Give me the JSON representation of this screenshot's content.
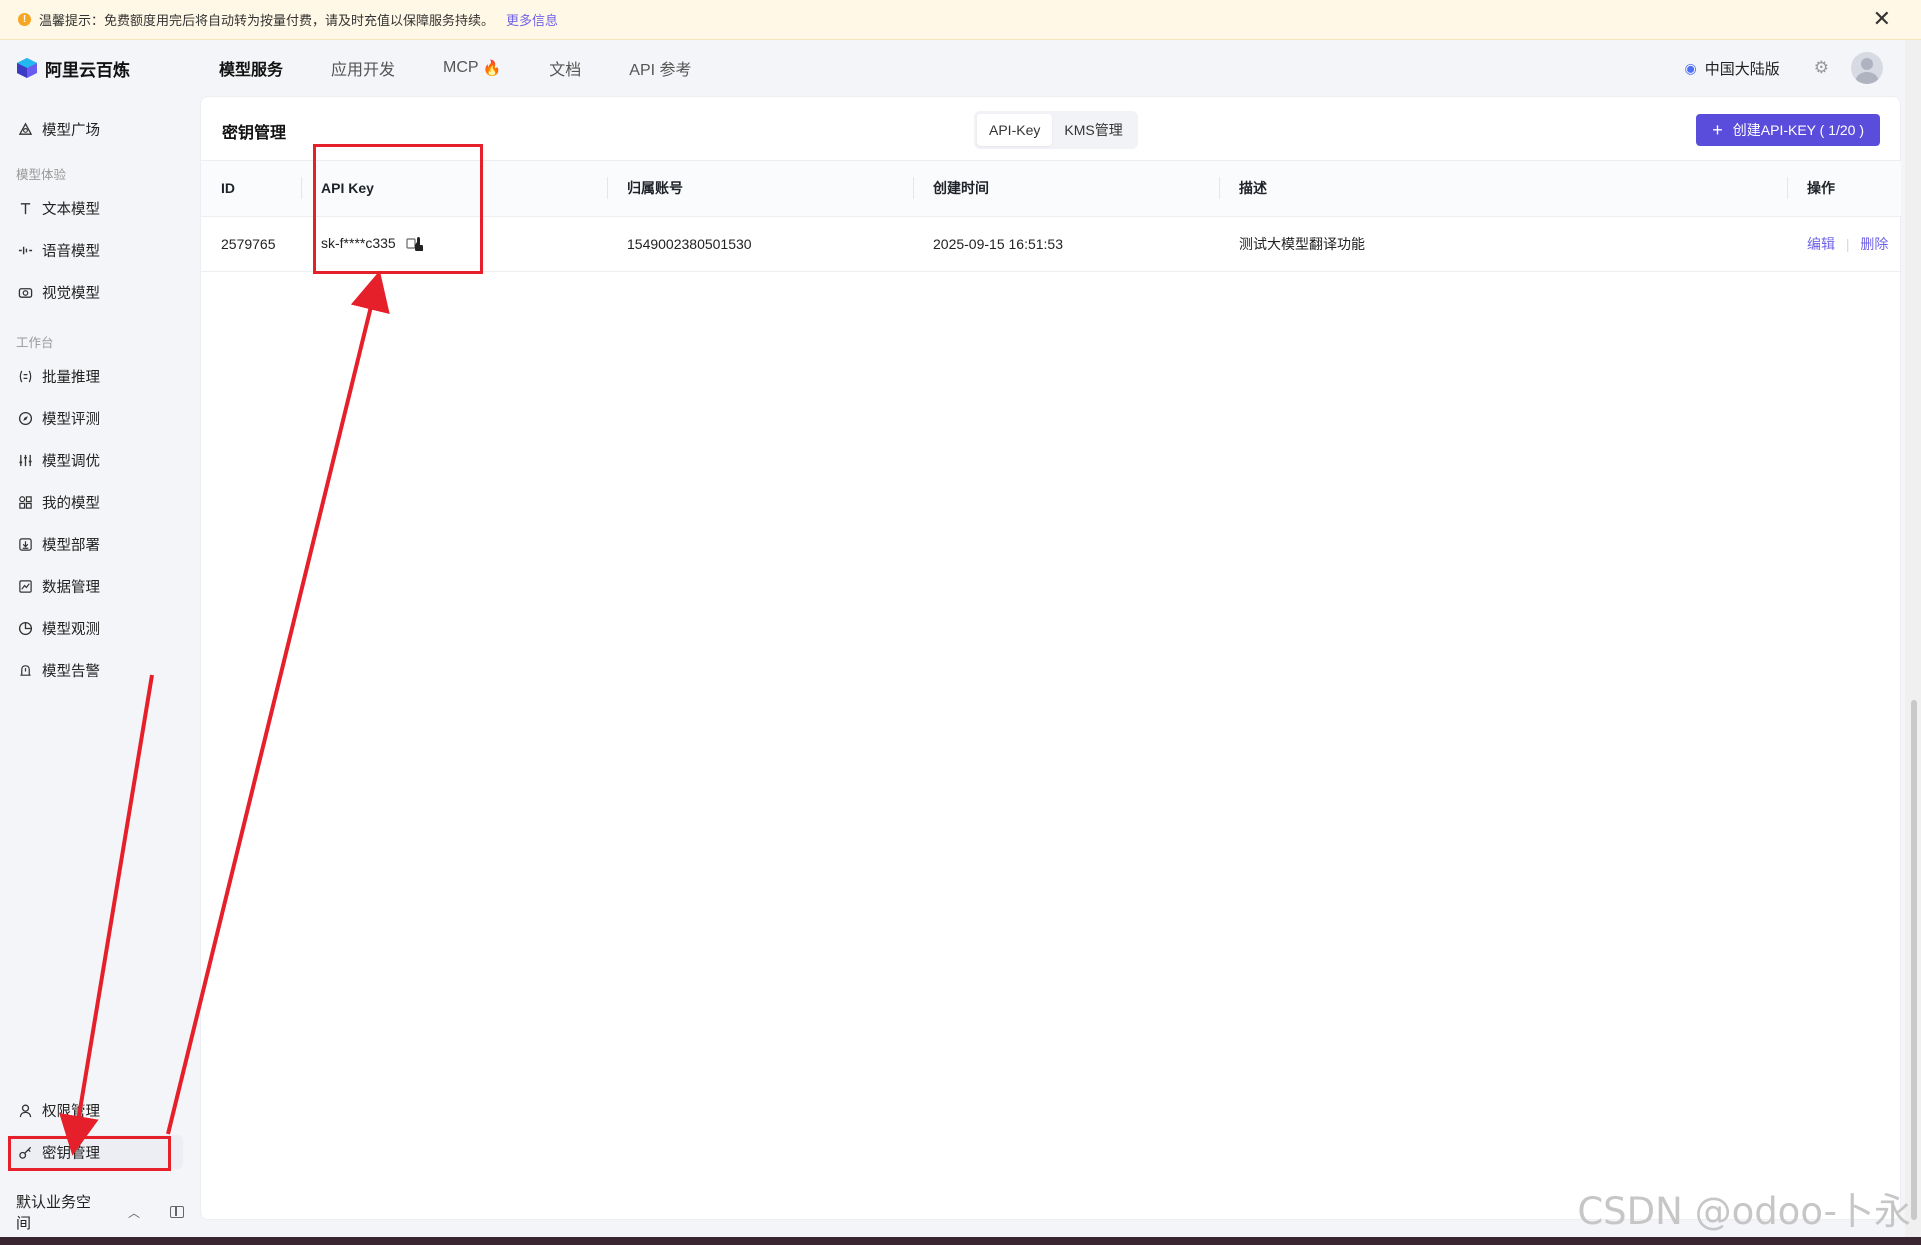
{
  "notice": {
    "text": "温馨提示：免费额度用完后将自动转为按量付费，请及时充值以保障服务持续。",
    "more_link": "更多信息"
  },
  "topnav": {
    "brand": "阿里云百炼",
    "items": [
      "模型服务",
      "应用开发",
      "MCP",
      "文档",
      "API 参考"
    ],
    "active": "模型服务",
    "region": "中国大陆版"
  },
  "sidebar": {
    "model_plaza": "模型广场",
    "group_experience": "模型体验",
    "experience_items": [
      "文本模型",
      "语音模型",
      "视觉模型"
    ],
    "group_workbench": "工作台",
    "workbench_items": [
      "批量推理",
      "模型评测",
      "模型调优",
      "我的模型",
      "模型部署",
      "数据管理",
      "模型观测",
      "模型告警"
    ],
    "bottom_items": [
      "权限管理",
      "密钥管理"
    ],
    "active": "密钥管理",
    "workspace": "默认业务空间"
  },
  "main": {
    "title": "密钥管理",
    "tabs": [
      "API-Key",
      "KMS管理"
    ],
    "active_tab": "API-Key",
    "create_button": "创建API-KEY ( 1/20 )",
    "table": {
      "columns": [
        "ID",
        "API Key",
        "归属账号",
        "创建时间",
        "描述",
        "操作"
      ],
      "rows": [
        {
          "id": "2579765",
          "api_key": "sk-f****c335",
          "account": "1549002380501530",
          "created": "2025-09-15 16:51:53",
          "description": "测试大模型翻译功能",
          "actions": [
            "编辑",
            "删除"
          ]
        }
      ]
    }
  },
  "watermark": "CSDN @odoo-卜永",
  "colors": {
    "accent": "#5b4ddb",
    "link": "#6f62e8",
    "annotation": "#e5202a",
    "notice_bg": "#fff8e6"
  }
}
